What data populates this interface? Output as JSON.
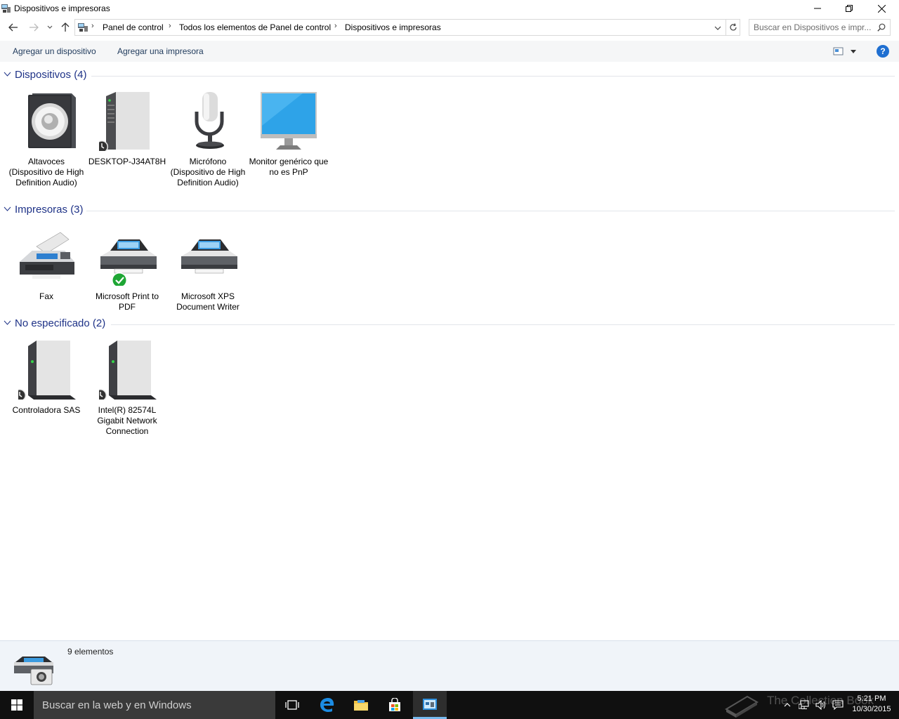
{
  "window": {
    "title": "Dispositivos e impresoras"
  },
  "address": {
    "breadcrumbs": [
      "Panel de control",
      "Todos los elementos de Panel de control",
      "Dispositivos e impresoras"
    ],
    "search_placeholder": "Buscar en Dispositivos e impr..."
  },
  "commands": {
    "add_device": "Agregar un dispositivo",
    "add_printer": "Agregar una impresora"
  },
  "groups": [
    {
      "title": "Dispositivos (4)",
      "items": [
        {
          "label": "Altavoces (Dispositivo de High Definition Audio)",
          "icon": "speaker-icon"
        },
        {
          "label": "DESKTOP-J34AT8H",
          "icon": "computer-tower-icon"
        },
        {
          "label": "Micrófono (Dispositivo de High Definition Audio)",
          "icon": "microphone-icon"
        },
        {
          "label": "Monitor genérico que no es PnP",
          "icon": "monitor-icon"
        }
      ]
    },
    {
      "title": "Impresoras (3)",
      "items": [
        {
          "label": "Fax",
          "icon": "fax-icon"
        },
        {
          "label": "Microsoft Print to PDF",
          "icon": "printer-icon",
          "default": true
        },
        {
          "label": "Microsoft XPS Document Writer",
          "icon": "printer-icon"
        }
      ]
    },
    {
      "title": "No especificado (2)",
      "items": [
        {
          "label": "Controladora SAS",
          "icon": "device-box-icon"
        },
        {
          "label": "Intel(R) 82574L Gigabit Network Connection",
          "icon": "device-box-icon"
        }
      ]
    }
  ],
  "details": {
    "count": "9 elementos"
  },
  "taskbar": {
    "search_text": "Buscar en la web y en Windows",
    "time": "5:21 PM",
    "date": "10/30/2015",
    "watermark": "The Collection Book"
  }
}
